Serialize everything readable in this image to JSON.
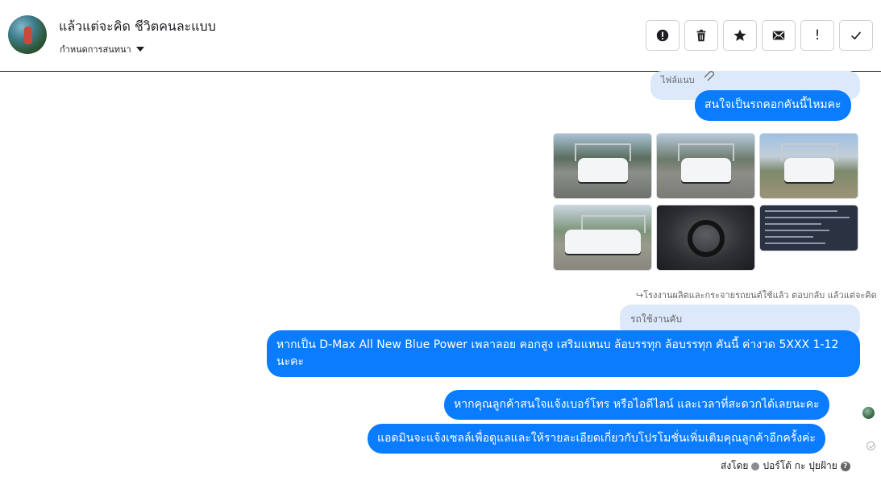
{
  "header": {
    "contact_name": "แล้วแต่จะคิด ชีวิตคนละแบบ",
    "assign_label": "กำหนดการสนทนา",
    "toolbar": [
      {
        "name": "report-spam-button",
        "icon": "alert-circle-icon"
      },
      {
        "name": "delete-button",
        "icon": "trash-icon"
      },
      {
        "name": "star-button",
        "icon": "star-icon"
      },
      {
        "name": "mark-unread-button",
        "icon": "envelope-icon"
      },
      {
        "name": "important-button",
        "icon": "exclamation-icon",
        "glyph": "!"
      },
      {
        "name": "mark-done-button",
        "icon": "check-icon"
      }
    ]
  },
  "thread": {
    "attachment_label": "ไฟล์แนบ",
    "message_1": "สนใจเป็นรถคอกคันนี้ไหมคะ",
    "photos": [
      "truck-front-photo",
      "truck-three-quarter-photo",
      "truck-rear-photo",
      "truck-side-photo",
      "truck-interior-photo",
      "listing-details-photo"
    ],
    "reply_caption": "โรงงานผลิตและกระจายรถยนต์ใช้แล้ว ตอบกลับ แล้วแต่จะคิด",
    "quoted_reply": "รถใช้งานคับ",
    "message_2": "หากเป็น D-Max All New Blue Power เพลาลอย คอกสูง เสริมแหนบ ล้อบรรทุก ล้อบรรทุก  คันนี้ ค่างวด 5XXX 1-12 นะคะ",
    "message_3": "หากคุณลูกค้าสนใจแจ้งเบอร์โทร หรือไอดีไลน์  และเวลาที่สะดวกได้เลยนะคะ",
    "message_4": "แอดมินจะแจ้งเซลล์เพื่อดูแลและให้รายละเอียดเกี่ยวกับโปรโมชั่นเพิ่มเติมคุณลูกค้าอีกครั้งค่ะ",
    "sent_by_label": "ส่งโดย",
    "sent_by_name": "ปอร์โต้ กะ ปุยฝ้าย"
  },
  "colors": {
    "outgoing_bubble": "#0a7cff",
    "quoted_bubble": "#dce9fb",
    "divider": "#1c1e21"
  }
}
